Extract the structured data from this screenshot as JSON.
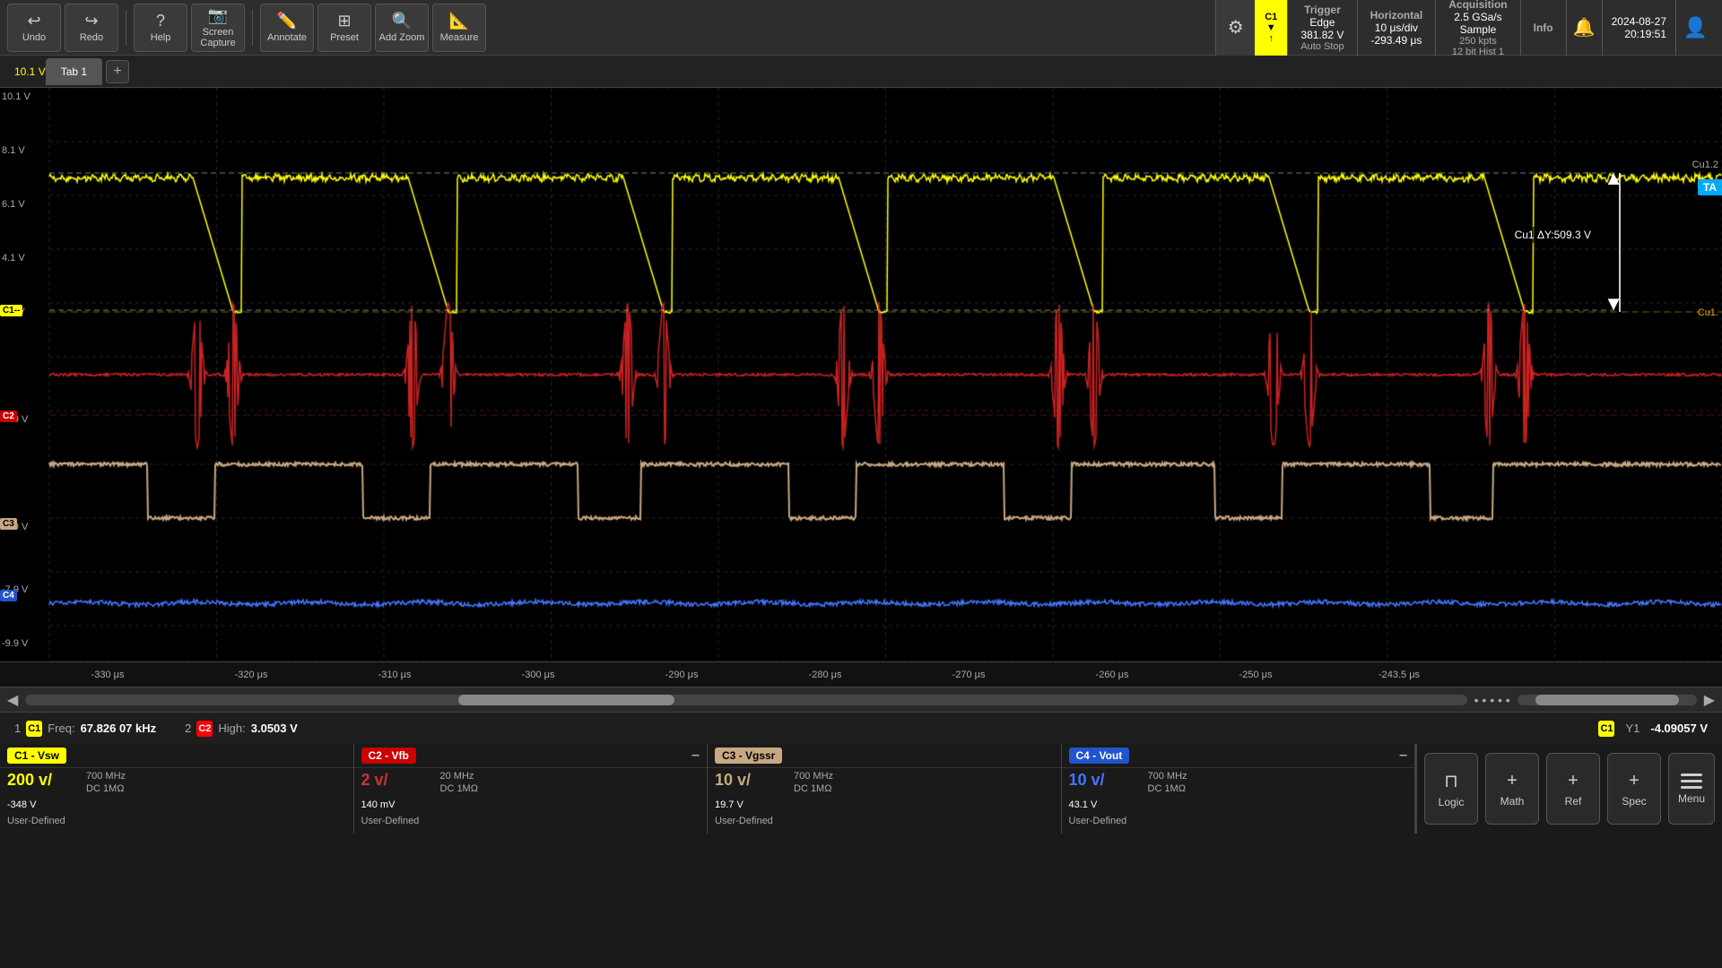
{
  "toolbar": {
    "undo_label": "Undo",
    "redo_label": "Redo",
    "help_label": "Help",
    "screen_capture_label": "Screen\nCapture",
    "annotate_label": "Annotate",
    "preset_label": "Preset",
    "add_zoom_label": "Add Zoom",
    "measure_label": "Measure"
  },
  "trigger": {
    "title": "Trigger",
    "type": "Edge",
    "value": "381.82 V",
    "mode1": "Auto",
    "mode2": "Stop"
  },
  "horizontal": {
    "title": "Horizontal",
    "div": "10 μs/div",
    "sample_rate": "2.5 GSa/s",
    "position": "-293.49 μs",
    "pts": "250 kpts"
  },
  "acquisition": {
    "title": "Acquisition",
    "mode": "Sample",
    "bits": "12 bit",
    "hist": "Hist 1"
  },
  "info_label": "Info",
  "datetime": {
    "date": "2024-08-27",
    "time": "20:19:51"
  },
  "tab": {
    "name": "Tab 1",
    "add_label": "+"
  },
  "scope": {
    "y_labels": [
      "10.1 V",
      "8.1 V",
      "6.1 V",
      "4.1 V",
      "2.1 V",
      "-1.9 V",
      "-5.9 V",
      "-7.9 V",
      "-9.9 V"
    ],
    "x_labels": [
      "-330 μs",
      "-320 μs",
      "-310 μs",
      "-300 μs",
      "-290 μs",
      "-280 μs",
      "-270 μs",
      "-260 μs",
      "-250 μs",
      "-243.5 μs"
    ],
    "cursor_label": "Cu1 ΔY:509.3 V",
    "ch1_marker": "C1",
    "ch2_marker": "C2",
    "ch3_marker": "C3",
    "ch4_marker": "C4",
    "cu1_badge": "Cu1.",
    "cu2_badge": "Cu1.2",
    "ta_badge": "TA"
  },
  "measurements": {
    "item1_num": "1",
    "item1_ch": "C1",
    "item1_label": "Freq:",
    "item1_val": "67.826 07 kHz",
    "item2_num": "2",
    "item2_ch": "C2",
    "item2_label": "High:",
    "item2_val": "3.0503 V",
    "right_ch": "C1",
    "right_y1": "Y1",
    "right_val": "-4.09057 V"
  },
  "channels": {
    "ch1": {
      "name": "C1 - Vsw",
      "scale": "200 v/",
      "bw": "700 MHz",
      "coupling": "DC 1MΩ",
      "offset": "-348 V",
      "user": "User-Defined"
    },
    "ch2": {
      "name": "C2 - Vfb",
      "dash": "–",
      "scale": "2 v/",
      "bw": "20 MHz",
      "coupling": "DC 1MΩ",
      "offset": "140 mV",
      "user": "User-Defined"
    },
    "ch3": {
      "name": "C3 - Vgssr",
      "scale": "10 v/",
      "bw": "700 MHz",
      "coupling": "DC 1MΩ",
      "offset": "19.7 V",
      "user": "User-Defined"
    },
    "ch4": {
      "name": "C4 - Vout",
      "dash": "–",
      "scale": "10 v/",
      "bw": "700 MHz",
      "coupling": "DC 1MΩ",
      "offset": "43.1 V",
      "user": "User-Defined"
    }
  },
  "right_buttons": {
    "logic_label": "Logic",
    "math_label": "Math",
    "ref_label": "Ref",
    "spec_label": "Spec",
    "menu_label": "Menu"
  }
}
